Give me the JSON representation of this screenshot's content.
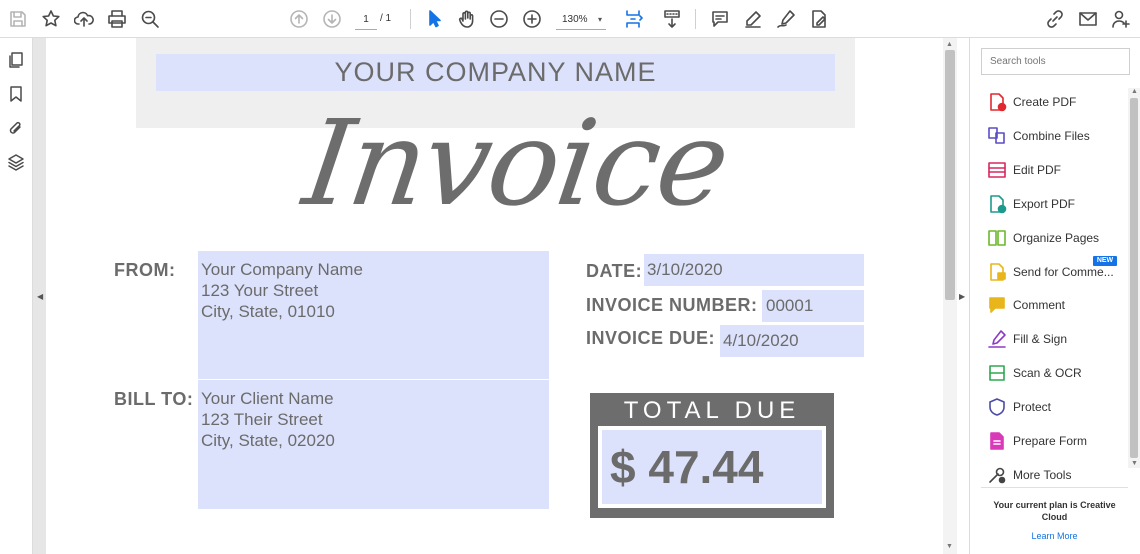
{
  "toolbar": {
    "current_page": "1",
    "page_total": "/ 1",
    "zoom": "130%",
    "zoom_caret": "▾"
  },
  "document": {
    "company_name": "YOUR COMPANY NAME",
    "invoice_title": "Invoice",
    "from_label": "FROM:",
    "from_lines": [
      "Your Company Name",
      "123 Your Street",
      "City, State, 01010"
    ],
    "bill_to_label": "BILL TO:",
    "bill_to_lines": [
      "Your Client Name",
      "123 Their Street",
      "City, State, 02020"
    ],
    "date_label": "DATE:",
    "date_value": "3/10/2020",
    "invoice_number_label": "INVOICE NUMBER:",
    "invoice_number_value": "00001",
    "invoice_due_label": "INVOICE DUE:",
    "invoice_due_value": "4/10/2020",
    "total_due_label": "TOTAL DUE",
    "total_due_value": "$ 47.44"
  },
  "tools_pane": {
    "search_placeholder": "Search tools",
    "tools": [
      {
        "label": "Create PDF",
        "icon": "create-pdf-icon",
        "color": "#e0282e"
      },
      {
        "label": "Combine Files",
        "icon": "combine-files-icon",
        "color": "#5c4bc7"
      },
      {
        "label": "Edit PDF",
        "icon": "edit-pdf-icon",
        "color": "#d9285e"
      },
      {
        "label": "Export PDF",
        "icon": "export-pdf-icon",
        "color": "#1d9a8b"
      },
      {
        "label": "Organize Pages",
        "icon": "organize-pages-icon",
        "color": "#6cb82d"
      },
      {
        "label": "Send for Comme...",
        "icon": "send-for-comments-icon",
        "color": "#e8b51a"
      },
      {
        "label": "Comment",
        "icon": "comment-icon",
        "color": "#e8b51a"
      },
      {
        "label": "Fill & Sign",
        "icon": "fill-sign-icon",
        "color": "#8c3bc6"
      },
      {
        "label": "Scan & OCR",
        "icon": "scan-ocr-icon",
        "color": "#2fa84f"
      },
      {
        "label": "Protect",
        "icon": "protect-icon",
        "color": "#4b4ba8"
      },
      {
        "label": "Prepare Form",
        "icon": "prepare-form-icon",
        "color": "#d93ab8"
      },
      {
        "label": "More Tools",
        "icon": "more-tools-icon",
        "color": "#444444"
      }
    ],
    "new_badge": "NEW",
    "plan_text": "Your current plan is Creative Cloud",
    "learn_more": "Learn More"
  },
  "colors": {
    "accent": "#1473e6",
    "form_field": "#dde2fc",
    "doc_gray": "#6b6b6b"
  }
}
